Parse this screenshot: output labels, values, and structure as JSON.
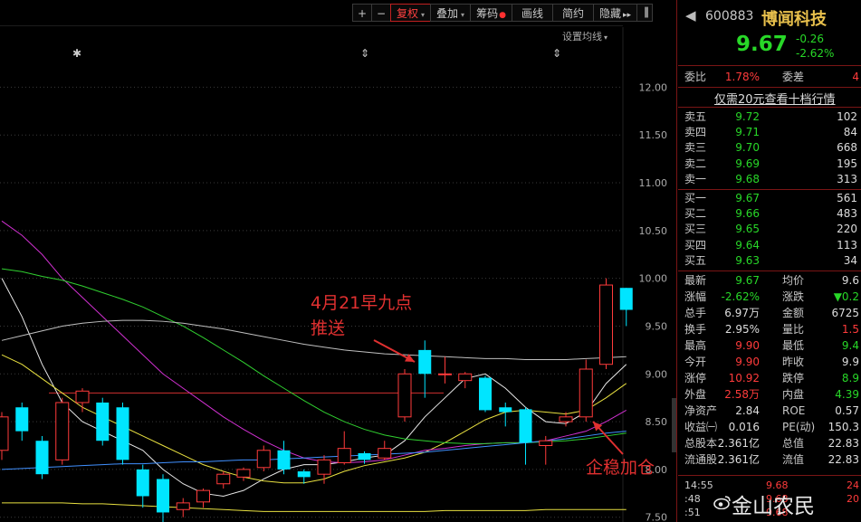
{
  "toolbar": {
    "plus": "+",
    "minus": "−",
    "fuquan": "复权",
    "diejia": "叠加",
    "chouma": "筹码",
    "huaxian": "画线",
    "jianyue": "简约",
    "yincang": "隐藏",
    "more": "▸▸",
    "collapse": "▐"
  },
  "ma_setting": "设置均线",
  "annotations": {
    "push_line1": "4月21早九点",
    "push_line2": "推送",
    "add_position": "企稳加仓"
  },
  "axis": {
    "ticks": [
      "12.00",
      "11.50",
      "11.00",
      "10.50",
      "10.00",
      "9.50",
      "9.00",
      "8.50",
      "8.00",
      "7.50"
    ]
  },
  "colors": {
    "up": "#ff3b3b",
    "down": "#00e5ff",
    "ma5": "#e8e8e8",
    "ma10": "#e8e040",
    "ma20": "#d030d0",
    "ma30": "#30d030",
    "ma60": "#c0c0c0"
  },
  "chart_data": {
    "type": "candlestick",
    "ylim": [
      7.45,
      12.25
    ],
    "candles": [
      {
        "o": 8.2,
        "c": 8.55,
        "h": 8.6,
        "l": 8.1
      },
      {
        "o": 8.65,
        "c": 8.4,
        "h": 8.7,
        "l": 8.3
      },
      {
        "o": 8.3,
        "c": 7.95,
        "h": 8.35,
        "l": 7.9
      },
      {
        "o": 8.1,
        "c": 8.7,
        "h": 8.75,
        "l": 8.05
      },
      {
        "o": 8.7,
        "c": 8.82,
        "h": 8.85,
        "l": 8.6
      },
      {
        "o": 8.7,
        "c": 8.3,
        "h": 8.75,
        "l": 8.25
      },
      {
        "o": 8.65,
        "c": 8.1,
        "h": 8.7,
        "l": 8.05
      },
      {
        "o": 8.0,
        "c": 7.72,
        "h": 8.05,
        "l": 7.6
      },
      {
        "o": 7.9,
        "c": 7.55,
        "h": 7.95,
        "l": 7.45
      },
      {
        "o": 7.58,
        "c": 7.65,
        "h": 7.7,
        "l": 7.5
      },
      {
        "o": 7.66,
        "c": 7.78,
        "h": 7.8,
        "l": 7.6
      },
      {
        "o": 7.85,
        "c": 7.95,
        "h": 7.98,
        "l": 7.8
      },
      {
        "o": 7.92,
        "c": 8.0,
        "h": 8.02,
        "l": 7.88
      },
      {
        "o": 8.02,
        "c": 8.2,
        "h": 8.25,
        "l": 7.98
      },
      {
        "o": 8.2,
        "c": 8.0,
        "h": 8.3,
        "l": 7.95
      },
      {
        "o": 7.98,
        "c": 7.92,
        "h": 8.0,
        "l": 7.85
      },
      {
        "o": 7.95,
        "c": 8.1,
        "h": 8.15,
        "l": 7.85
      },
      {
        "o": 8.07,
        "c": 8.22,
        "h": 8.4,
        "l": 8.05
      },
      {
        "o": 8.17,
        "c": 8.1,
        "h": 8.19,
        "l": 8.06
      },
      {
        "o": 8.12,
        "c": 8.22,
        "h": 8.3,
        "l": 8.1
      },
      {
        "o": 8.55,
        "c": 9.0,
        "h": 9.05,
        "l": 8.5
      },
      {
        "o": 9.25,
        "c": 9.0,
        "h": 9.35,
        "l": 8.75
      },
      {
        "o": 9.0,
        "c": 9.0,
        "h": 9.18,
        "l": 8.9
      },
      {
        "o": 8.93,
        "c": 9.0,
        "h": 9.02,
        "l": 8.85
      },
      {
        "o": 8.96,
        "c": 8.62,
        "h": 8.98,
        "l": 8.6
      },
      {
        "o": 8.65,
        "c": 8.6,
        "h": 8.7,
        "l": 8.45
      },
      {
        "o": 8.63,
        "c": 8.28,
        "h": 8.65,
        "l": 8.05
      },
      {
        "o": 8.25,
        "c": 8.3,
        "h": 8.35,
        "l": 8.05
      },
      {
        "o": 8.5,
        "c": 8.55,
        "h": 8.6,
        "l": 8.45
      },
      {
        "o": 8.55,
        "c": 9.05,
        "h": 9.15,
        "l": 8.5
      },
      {
        "o": 9.1,
        "c": 9.93,
        "h": 10.0,
        "l": 9.05
      },
      {
        "o": 9.9,
        "c": 9.67,
        "h": 9.9,
        "l": 9.5
      }
    ],
    "reference_line": 8.8,
    "ma_lines": [
      {
        "name": "MA5",
        "values": [
          10.0,
          9.6,
          9.1,
          8.7,
          8.5,
          8.4,
          8.3,
          8.2,
          8.0,
          7.85,
          7.75,
          7.72,
          7.78,
          7.9,
          8.0,
          8.05,
          8.05,
          8.08,
          8.12,
          8.15,
          8.3,
          8.55,
          8.75,
          8.95,
          9.0,
          8.85,
          8.65,
          8.5,
          8.48,
          8.6,
          8.9,
          9.1
        ]
      },
      {
        "name": "MA10",
        "values": [
          9.2,
          9.1,
          8.95,
          8.8,
          8.65,
          8.55,
          8.45,
          8.35,
          8.25,
          8.15,
          8.05,
          7.98,
          7.92,
          7.88,
          7.86,
          7.86,
          7.9,
          7.98,
          8.04,
          8.08,
          8.12,
          8.18,
          8.28,
          8.4,
          8.52,
          8.6,
          8.62,
          8.6,
          8.58,
          8.62,
          8.75,
          8.9
        ]
      },
      {
        "name": "MA20",
        "values": [
          10.6,
          10.45,
          10.25,
          10.0,
          9.8,
          9.6,
          9.4,
          9.2,
          9.0,
          8.85,
          8.7,
          8.55,
          8.42,
          8.3,
          8.2,
          8.12,
          8.08,
          8.07,
          8.08,
          8.1,
          8.15,
          8.2,
          8.22,
          8.25,
          8.27,
          8.28,
          8.28,
          8.3,
          8.35,
          8.4,
          8.5,
          8.62
        ]
      },
      {
        "name": "MA30",
        "values": [
          10.1,
          10.07,
          10.02,
          9.98,
          9.92,
          9.85,
          9.78,
          9.7,
          9.6,
          9.5,
          9.38,
          9.25,
          9.12,
          8.98,
          8.85,
          8.72,
          8.6,
          8.5,
          8.42,
          8.36,
          8.32,
          8.3,
          8.28,
          8.27,
          8.27,
          8.28,
          8.28,
          8.29,
          8.3,
          8.32,
          8.35,
          8.38
        ]
      },
      {
        "name": "MA60",
        "values": [
          9.35,
          9.4,
          9.45,
          9.5,
          9.53,
          9.55,
          9.56,
          9.56,
          9.55,
          9.53,
          9.5,
          9.47,
          9.43,
          9.39,
          9.35,
          9.31,
          9.28,
          9.25,
          9.23,
          9.21,
          9.2,
          9.19,
          9.18,
          9.17,
          9.16,
          9.16,
          9.15,
          9.15,
          9.15,
          9.16,
          9.17,
          9.18
        ]
      },
      {
        "name": "MA-long",
        "values": [
          7.65,
          7.65,
          7.65,
          7.65,
          7.64,
          7.64,
          7.63,
          7.62,
          7.61,
          7.6,
          7.59,
          7.58,
          7.57,
          7.56,
          7.56,
          7.56,
          7.56,
          7.56,
          7.56,
          7.56,
          7.56,
          7.56,
          7.57,
          7.57,
          7.57,
          7.57,
          7.57,
          7.58,
          7.58,
          7.58,
          7.58,
          7.58
        ]
      }
    ],
    "mid_line": {
      "name": "MA-blue",
      "values": [
        8.0,
        8.01,
        8.02,
        8.03,
        8.04,
        8.05,
        8.06,
        8.06,
        8.07,
        8.08,
        8.08,
        8.09,
        8.1,
        8.1,
        8.11,
        8.12,
        8.13,
        8.14,
        8.15,
        8.16,
        8.17,
        8.18,
        8.2,
        8.22,
        8.24,
        8.26,
        8.28,
        8.3,
        8.32,
        8.35,
        8.38,
        8.4
      ]
    }
  },
  "quote": {
    "code": "600883",
    "name": "博闻科技",
    "price": "9.67",
    "change": "-0.26",
    "change_pct": "-2.62%",
    "weibi_label": "委比",
    "weibi": "1.78%",
    "weicha_label": "委差",
    "weicha": "4",
    "promo": "仅需20元查看十档行情",
    "asks": [
      {
        "label": "卖五",
        "price": "9.72",
        "vol": "102"
      },
      {
        "label": "卖四",
        "price": "9.71",
        "vol": "84"
      },
      {
        "label": "卖三",
        "price": "9.70",
        "vol": "668"
      },
      {
        "label": "卖二",
        "price": "9.69",
        "vol": "195"
      },
      {
        "label": "卖一",
        "price": "9.68",
        "vol": "313"
      }
    ],
    "bids": [
      {
        "label": "买一",
        "price": "9.67",
        "vol": "561"
      },
      {
        "label": "买二",
        "price": "9.66",
        "vol": "483"
      },
      {
        "label": "买三",
        "price": "9.65",
        "vol": "220"
      },
      {
        "label": "买四",
        "price": "9.64",
        "vol": "113"
      },
      {
        "label": "买五",
        "price": "9.63",
        "vol": "34"
      }
    ],
    "stats": [
      {
        "l1": "最新",
        "v1": "9.67",
        "c1": "green",
        "l2": "均价",
        "v2": "9.6",
        "c2": "white"
      },
      {
        "l1": "涨幅",
        "v1": "-2.62%",
        "c1": "green",
        "l2": "涨跌",
        "v2": "▼0.2",
        "c2": "green"
      },
      {
        "l1": "总手",
        "v1": "6.97万",
        "c1": "white",
        "l2": "金额",
        "v2": "6725",
        "c2": "white"
      },
      {
        "l1": "换手",
        "v1": "2.95%",
        "c1": "white",
        "l2": "量比",
        "v2": "1.5",
        "c2": "red"
      },
      {
        "l1": "最高",
        "v1": "9.90",
        "c1": "red",
        "l2": "最低",
        "v2": "9.4",
        "c2": "green"
      },
      {
        "l1": "今开",
        "v1": "9.90",
        "c1": "red",
        "l2": "昨收",
        "v2": "9.9",
        "c2": "white"
      },
      {
        "l1": "涨停",
        "v1": "10.92",
        "c1": "red",
        "l2": "跌停",
        "v2": "8.9",
        "c2": "green"
      },
      {
        "l1": "外盘",
        "v1": "2.58万",
        "c1": "red",
        "l2": "内盘",
        "v2": "4.39",
        "c2": "green"
      },
      {
        "l1": "净资产",
        "v1": "2.84",
        "c1": "white",
        "l2": "ROE",
        "v2": "0.57",
        "c2": "white"
      },
      {
        "l1": "收益㈠",
        "v1": "0.016",
        "c1": "white",
        "l2": "PE(动)",
        "v2": "150.3",
        "c2": "white"
      },
      {
        "l1": "总股本",
        "v1": "2.361亿",
        "c1": "white",
        "l2": "总值",
        "v2": "22.83",
        "c2": "white"
      },
      {
        "l1": "流通股",
        "v1": "2.361亿",
        "c1": "white",
        "l2": "流值",
        "v2": "22.83",
        "c2": "white"
      }
    ],
    "ticks": [
      {
        "time": "14:55",
        "price": "9.68",
        "vol": "24"
      },
      {
        "time": ":48",
        "price": "9.68",
        "vol": "20"
      },
      {
        "time": ":51",
        "price": "9.68",
        "vol": ""
      }
    ]
  },
  "watermark": "金山农民"
}
